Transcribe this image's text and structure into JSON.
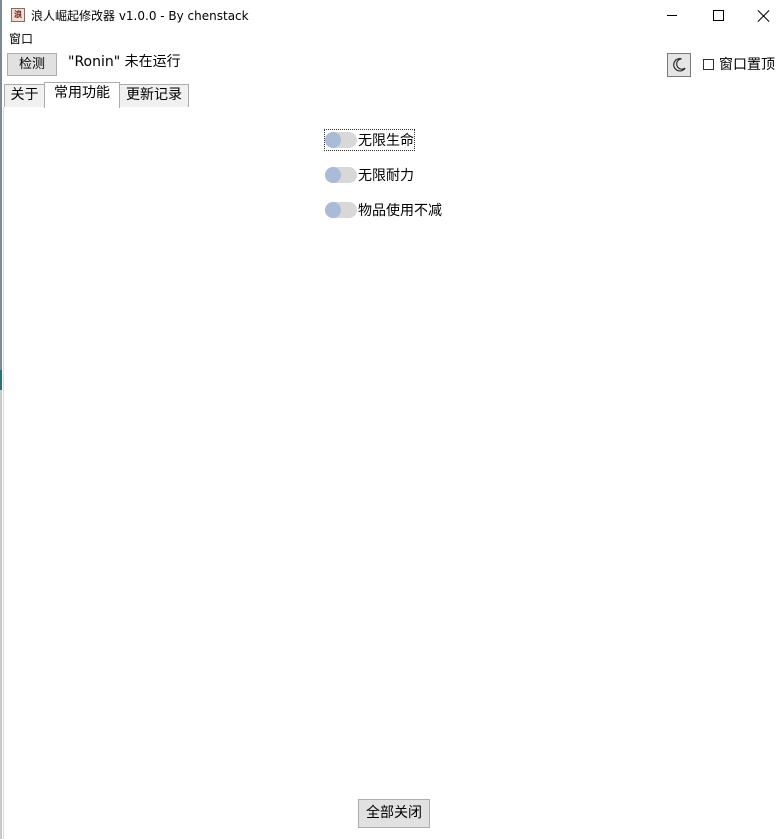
{
  "window": {
    "title": "浪人崛起修改器 v1.0.0 - By chenstack",
    "icon": "app-icon",
    "minimize_icon": "minimize-icon",
    "maximize_icon": "maximize-icon",
    "close_icon": "close-icon"
  },
  "menu": {
    "window_label": "窗口"
  },
  "toolbar": {
    "detect_label": "检测",
    "status": "\"Ronin\" 未在运行",
    "theme_icon": "moon-icon",
    "topmost_label": "窗口置顶",
    "topmost_checked": false
  },
  "tabs": [
    {
      "label": "关于",
      "active": false
    },
    {
      "label": "常用功能",
      "active": true
    },
    {
      "label": "更新记录",
      "active": false
    }
  ],
  "features": [
    {
      "label": "无限生命",
      "enabled": false
    },
    {
      "label": "无限耐力",
      "enabled": false
    },
    {
      "label": "物品使用不减",
      "enabled": false
    }
  ],
  "footer": {
    "close_all_label": "全部关闭"
  },
  "colors": {
    "toggle_track": "#d8d8d8",
    "toggle_knob": "#a9bbd6",
    "button_bg": "#e1e1e1"
  }
}
